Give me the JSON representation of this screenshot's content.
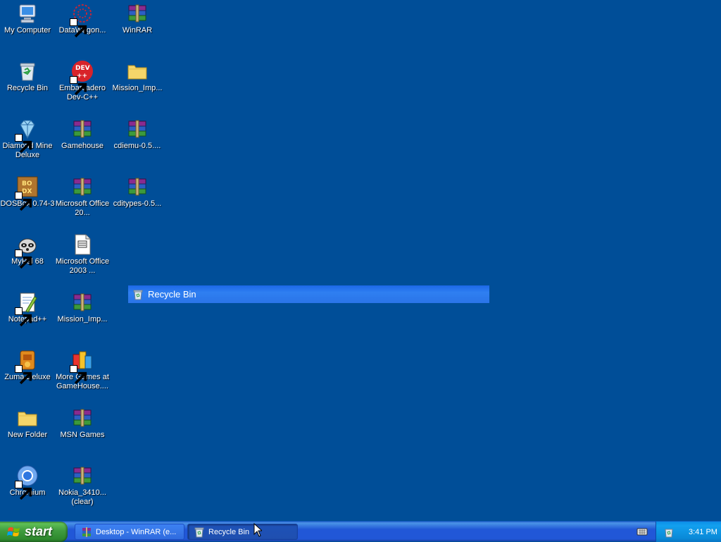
{
  "desktop": {
    "icons": [
      {
        "label": "My Computer",
        "icon": "my-computer-icon",
        "shortcut": false
      },
      {
        "label": "DataWagon...",
        "icon": "datawagon-icon",
        "shortcut": true
      },
      {
        "label": "WinRAR",
        "icon": "winrar-archive-icon",
        "shortcut": false
      },
      {
        "label": "Recycle Bin",
        "icon": "recycle-bin-icon",
        "shortcut": false
      },
      {
        "label": "Embarcadero Dev-C++",
        "icon": "dev-cpp-icon",
        "shortcut": true
      },
      {
        "label": "Mission_Imp...",
        "icon": "folder-icon",
        "shortcut": false
      },
      {
        "label": "Diamond Mine Deluxe",
        "icon": "diamond-icon",
        "shortcut": true
      },
      {
        "label": "Gamehouse",
        "icon": "winrar-archive-icon",
        "shortcut": false
      },
      {
        "label": "cdiemu-0.5....",
        "icon": "winrar-archive-icon",
        "shortcut": false
      },
      {
        "label": "DOSBox 0.74-3",
        "icon": "dosbox-icon",
        "shortcut": true
      },
      {
        "label": "Microsoft Office 20...",
        "icon": "winrar-archive-icon",
        "shortcut": false
      },
      {
        "label": "cditypes-0.5...",
        "icon": "winrar-archive-icon",
        "shortcut": false
      },
      {
        "label": "MyPal 68",
        "icon": "mypal-raccoon-icon",
        "shortcut": true
      },
      {
        "label": "Microsoft Office 2003 ...",
        "icon": "document-icon",
        "shortcut": false
      },
      {
        "label": "Notepad++",
        "icon": "notepad-plus-plus-icon",
        "shortcut": true
      },
      {
        "label": "Mission_Imp...",
        "icon": "winrar-archive-icon",
        "shortcut": false
      },
      {
        "label": "Zuma Deluxe",
        "icon": "zuma-icon",
        "shortcut": true
      },
      {
        "label": "More Games at GameHouse....",
        "icon": "gamehouse-icon",
        "shortcut": true
      },
      {
        "label": "New Folder",
        "icon": "folder-icon",
        "shortcut": false
      },
      {
        "label": "MSN Games",
        "icon": "winrar-archive-icon",
        "shortcut": false
      },
      {
        "label": "Chromium",
        "icon": "chromium-icon",
        "shortcut": true
      },
      {
        "label": "Nokia_3410... (clear)",
        "icon": "winrar-archive-icon",
        "shortcut": false
      }
    ]
  },
  "drag_ghost": {
    "label": "Recycle Bin",
    "icon": "recycle-bin-icon"
  },
  "taskbar": {
    "start_label": "start",
    "tasks": [
      {
        "label": "Desktop - WinRAR (e...",
        "icon": "winrar-archive-icon"
      },
      {
        "label": "Recycle Bin",
        "icon": "recycle-bin-icon"
      }
    ],
    "quick_icon": "keyboard-icon",
    "tray_icon": "network-icon",
    "clock": "3:41 PM"
  },
  "colors": {
    "desktop_bg": "#004e98",
    "taskbar_blue": "#2157d7",
    "start_green": "#3f9c3f",
    "tray_blue": "#0c8fe7",
    "highlight_blue": "#2f7ff1"
  }
}
